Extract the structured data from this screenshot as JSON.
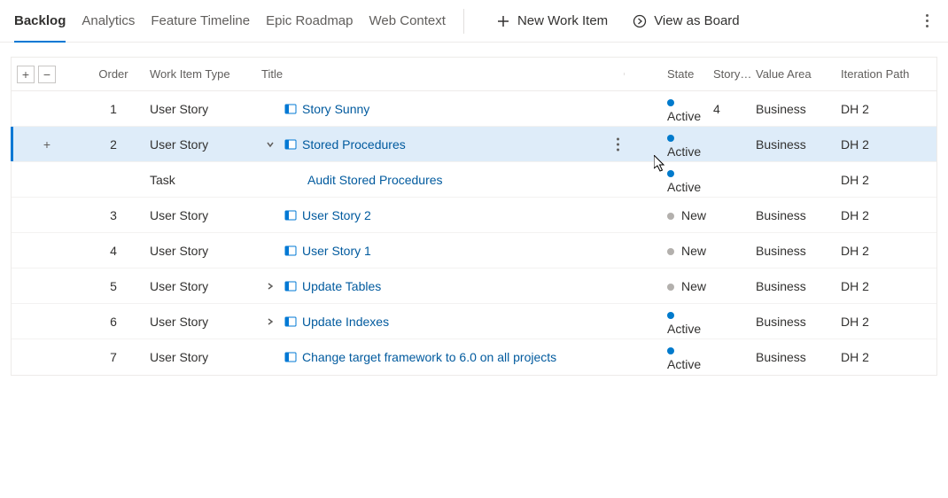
{
  "tabs": [
    {
      "label": "Backlog",
      "active": true
    },
    {
      "label": "Analytics"
    },
    {
      "label": "Feature Timeline"
    },
    {
      "label": "Epic Roadmap"
    },
    {
      "label": "Web Context"
    }
  ],
  "actions": {
    "new_work_item": "New Work Item",
    "view_as_board": "View as Board"
  },
  "columns": {
    "order": "Order",
    "work_item_type": "Work Item Type",
    "title": "Title",
    "state": "State",
    "story": "Story…",
    "value_area": "Value Area",
    "iteration_path": "Iteration Path"
  },
  "rows": [
    {
      "order": "1",
      "type": "User Story",
      "icon": "story",
      "title": "Story Sunny",
      "state": "Active",
      "state_kind": "active",
      "story": "4",
      "value": "Business",
      "iter": "DH 2",
      "selected": false
    },
    {
      "order": "2",
      "type": "User Story",
      "icon": "story",
      "title": "Stored Procedures",
      "state": "Active",
      "state_kind": "active",
      "story": "",
      "value": "Business",
      "iter": "DH 2",
      "selected": true,
      "expand": "open",
      "rowmenu": true,
      "showplus": true
    },
    {
      "order": "",
      "type": "Task",
      "icon": "task",
      "title": "Audit Stored Procedures",
      "state": "Active",
      "state_kind": "active",
      "story": "",
      "value": "",
      "iter": "DH 2",
      "child": true
    },
    {
      "order": "3",
      "type": "User Story",
      "icon": "story",
      "title": "User Story 2",
      "state": "New",
      "state_kind": "new",
      "story": "",
      "value": "Business",
      "iter": "DH 2"
    },
    {
      "order": "4",
      "type": "User Story",
      "icon": "story",
      "title": "User Story 1",
      "state": "New",
      "state_kind": "new",
      "story": "",
      "value": "Business",
      "iter": "DH 2"
    },
    {
      "order": "5",
      "type": "User Story",
      "icon": "story",
      "title": "Update Tables",
      "state": "New",
      "state_kind": "new",
      "story": "",
      "value": "Business",
      "iter": "DH 2",
      "expand": "closed"
    },
    {
      "order": "6",
      "type": "User Story",
      "icon": "story",
      "title": "Update Indexes",
      "state": "Active",
      "state_kind": "active",
      "story": "",
      "value": "Business",
      "iter": "DH 2",
      "expand": "closed"
    },
    {
      "order": "7",
      "type": "User Story",
      "icon": "story",
      "title": "Change target framework to 6.0 on all projects",
      "state": "Active",
      "state_kind": "active",
      "story": "",
      "value": "Business",
      "iter": "DH 2"
    }
  ]
}
